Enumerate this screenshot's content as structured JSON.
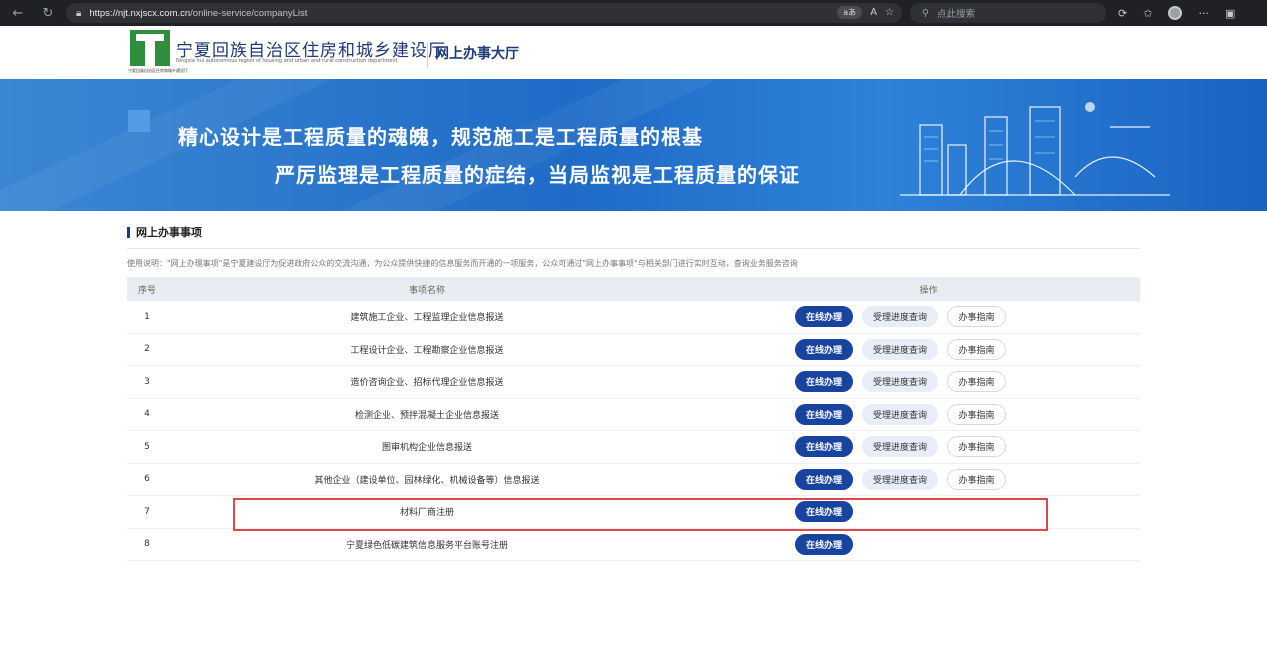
{
  "browser": {
    "url_host": "https://njt.nxjscx.com.cn",
    "url_path": "/online-service/companyList",
    "reader_label": "aあ",
    "font_label": "A",
    "search_placeholder": "点此搜索",
    "menu_label": "···"
  },
  "site": {
    "title": "宁夏回族自治区住房和城乡建设厅",
    "title_en": "Ningxia hui autonomous region of housing and urban and rural construction department",
    "logo_caption": "宁夏回族自治区住房和城乡建设厅",
    "hall_title": "网上办事大厅"
  },
  "banner": {
    "line1": "精心设计是工程质量的魂魄，规范施工是工程质量的根基",
    "line2": "严厉监理是工程质量的症结，当局监视是工程质量的保证"
  },
  "section": {
    "title": "网上办事事项",
    "usage": "使用说明：\"网上办理事项\"是宁夏建设厅为促进政府公众的交流沟通，为公众提供快捷的信息服务而开通的一项服务，公众可通过\"网上办事事项\"与相关部门进行实时互动，查询业务服务咨询"
  },
  "table": {
    "headers": {
      "no": "序号",
      "name": "事项名称",
      "op": "操作"
    },
    "btn_online": "在线办理",
    "btn_progress": "受理进度查询",
    "btn_guide": "办事指南",
    "rows": [
      {
        "no": "1",
        "name": "建筑施工企业、工程监理企业信息报送"
      },
      {
        "no": "2",
        "name": "工程设计企业、工程勘察企业信息报送"
      },
      {
        "no": "3",
        "name": "造价咨询企业、招标代理企业信息报送"
      },
      {
        "no": "4",
        "name": "检测企业、预拌混凝土企业信息报送"
      },
      {
        "no": "5",
        "name": "图审机构企业信息报送"
      },
      {
        "no": "6",
        "name": "其他企业（建设单位、园林绿化、机械设备等）信息报送"
      },
      {
        "no": "7",
        "name": "材料厂商注册"
      },
      {
        "no": "8",
        "name": "宁夏绿色低碳建筑信息服务平台账号注册"
      }
    ]
  },
  "colors": {
    "primary": "#1844a0",
    "highlight": "#e04848",
    "banner": "#1f6bc7"
  }
}
